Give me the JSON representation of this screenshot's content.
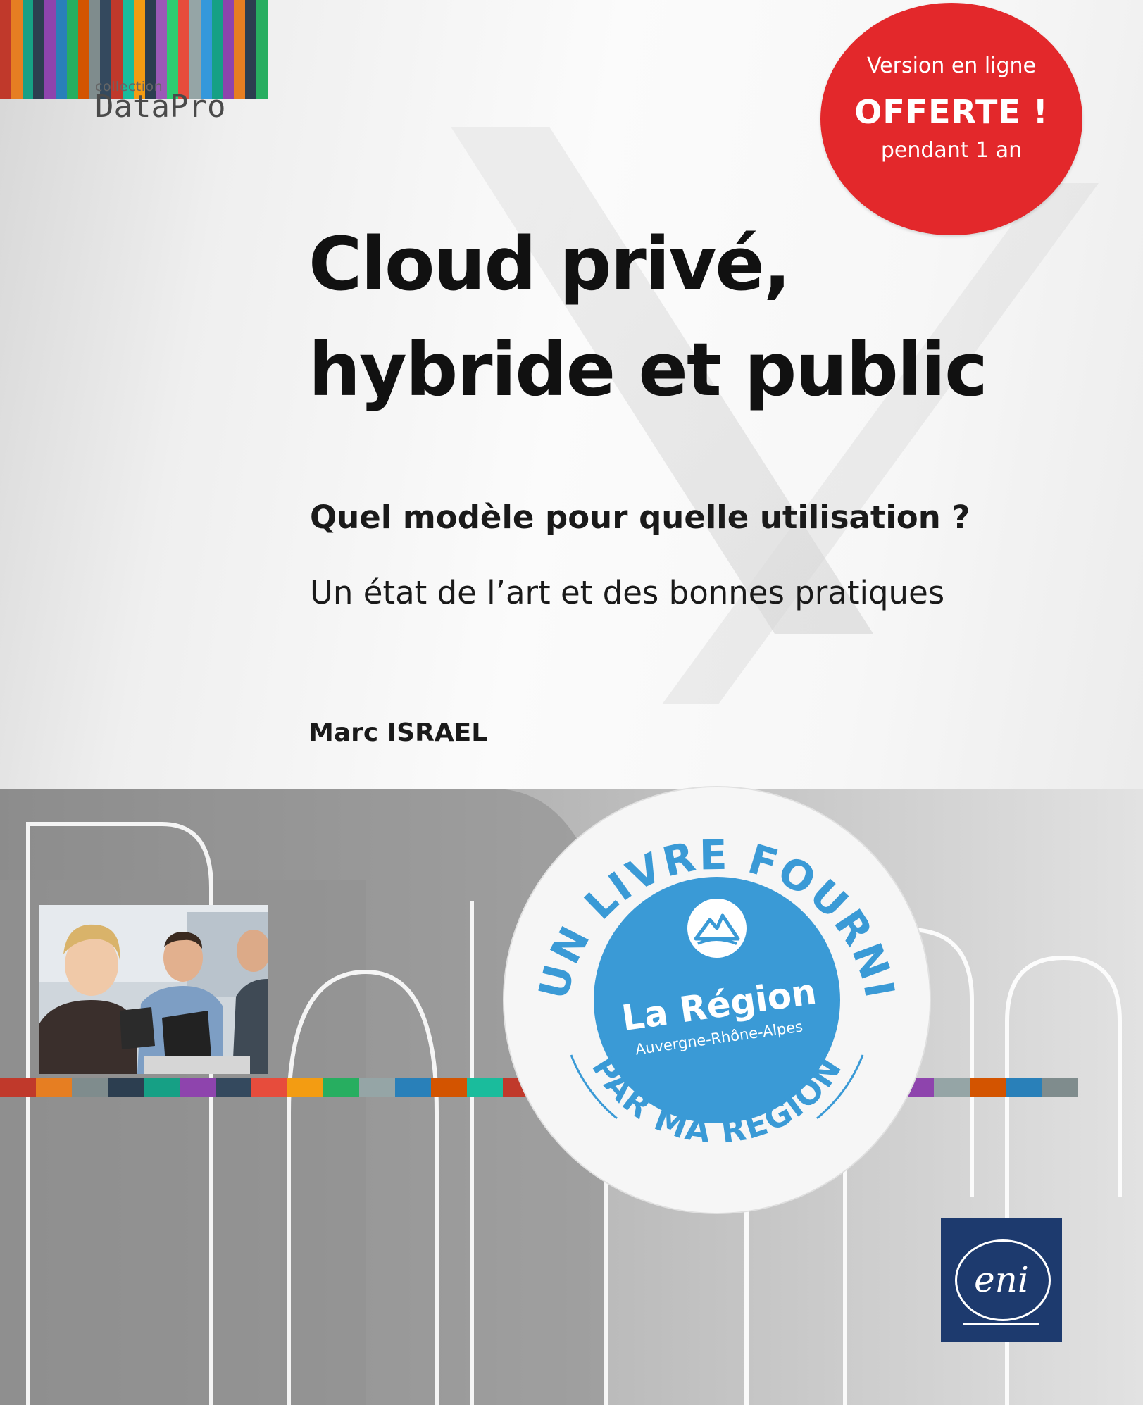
{
  "collection": {
    "label": "collection",
    "name": "DataPro",
    "stripe_colors": [
      "#c0392b",
      "#e67e22",
      "#16a085",
      "#2c3e50",
      "#8e44ad",
      "#2980b9",
      "#27ae60",
      "#d35400",
      "#7f8c8d",
      "#34495e",
      "#c0392b",
      "#1abc9c",
      "#f39c12",
      "#2c3e50",
      "#9b59b6",
      "#2ecc71",
      "#e74c3c",
      "#95a5a6",
      "#3498db",
      "#16a085",
      "#8e44ad",
      "#e67e22",
      "#2c3e50",
      "#27ae60"
    ]
  },
  "offer_badge": {
    "line1": "Version en ligne",
    "line2": "OFFERTE !",
    "line3": "pendant 1 an",
    "color": "#e3282b"
  },
  "book": {
    "title_line1": "Cloud privé,",
    "title_line2": "hybride et public",
    "subtitle": "Quel modèle pour quelle utilisation ?",
    "tagline": "Un état de l’art et des bonnes pratiques",
    "author": "Marc ISRAEL"
  },
  "region_sticker": {
    "top_text": "UN LIVRE FOURNI",
    "bottom_text": "PAR MA RÉGION",
    "region_name": "La Région",
    "region_sub": "Auvergne-Rhône-Alpes",
    "accent_color": "#3a9ad6",
    "logo_icon": "mountain-icon"
  },
  "publisher": {
    "name": "eni",
    "color": "#1d3a6e"
  },
  "colorbar": [
    "#c0392b",
    "#e67e22",
    "#7f8c8d",
    "#2c3e50",
    "#16a085",
    "#8e44ad",
    "#34495e",
    "#e74c3c",
    "#f39c12",
    "#27ae60",
    "#95a5a6",
    "#2980b9",
    "#d35400",
    "#1abc9c",
    "#c0392b",
    "#bdc3c7",
    "#7f8c8d",
    "#e67e22",
    "#2c3e50",
    "#9b59b6",
    "#16a085",
    "#e74c3c",
    "#34495e",
    "#f1c40f",
    "#27ae60",
    "#8e44ad",
    "#95a5a6",
    "#d35400",
    "#2980b9",
    "#7f8c8d"
  ]
}
